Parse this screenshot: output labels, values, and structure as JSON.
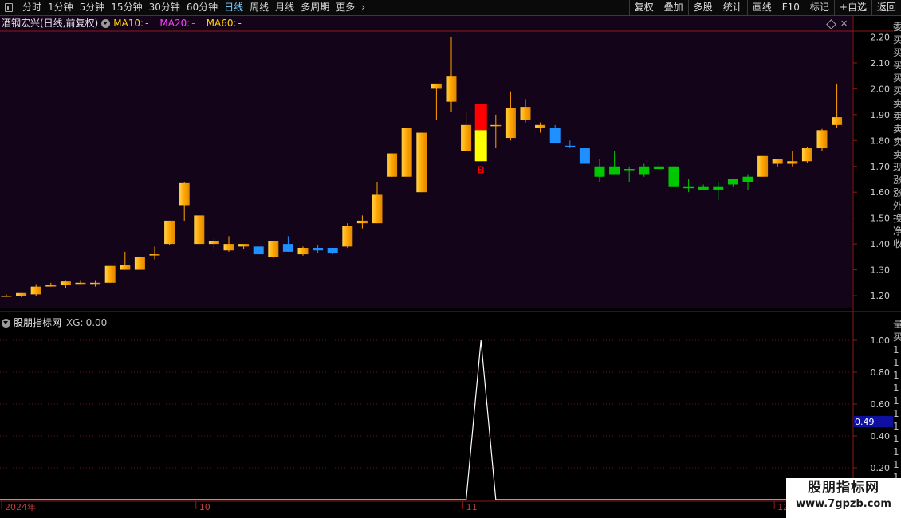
{
  "toolbar": {
    "periods": [
      {
        "label": "分时",
        "active": false
      },
      {
        "label": "1分钟",
        "active": false
      },
      {
        "label": "5分钟",
        "active": false
      },
      {
        "label": "15分钟",
        "active": false
      },
      {
        "label": "30分钟",
        "active": false
      },
      {
        "label": "60分钟",
        "active": false
      },
      {
        "label": "日线",
        "active": true
      },
      {
        "label": "周线",
        "active": false
      },
      {
        "label": "月线",
        "active": false
      },
      {
        "label": "多周期",
        "active": false
      },
      {
        "label": "更多",
        "active": false
      }
    ],
    "buttons": [
      "复权",
      "叠加",
      "多股",
      "统计",
      "画线",
      "F10",
      "标记",
      "+自选",
      "返回"
    ]
  },
  "main": {
    "stock_name": "酒钢宏兴(日线,前复权)",
    "ma": [
      {
        "label": "MA10:",
        "value": "-",
        "color": "#ffd700"
      },
      {
        "label": "MA20:",
        "value": "-",
        "color": "#ff40ff"
      },
      {
        "label": "MA60:",
        "value": "-",
        "color": "#ffd700"
      }
    ]
  },
  "indicator": {
    "name": "股朋指标网",
    "xg_label": "XG:",
    "xg_value": "0.00",
    "cursor_value": "0.49"
  },
  "watermark": {
    "line1": "股朋指标网",
    "line2": "www.7gpzb.com"
  },
  "right_strip_main": [
    "委",
    "买",
    "买",
    "买",
    "买",
    "买",
    "卖",
    "卖",
    "卖",
    "卖",
    "卖",
    "现",
    "涨",
    "涨",
    "外",
    "换",
    "净",
    "收"
  ],
  "right_strip_ind": [
    "量",
    "买",
    "1",
    "1",
    "1",
    "1",
    "1",
    "1",
    "1",
    "1",
    "1",
    "1",
    "1",
    "1",
    "1"
  ],
  "colors": {
    "up": "#ffa500",
    "up_light": "#ffd24a",
    "blue": "#1e90ff",
    "green": "#00c800",
    "signal_red": "#ff0000",
    "signal_yellow": "#ffff00",
    "panel_bg": "#14041a",
    "axis": "#8b1a1a"
  },
  "chart_data": [
    {
      "type": "candlestick",
      "title": "酒钢宏兴(日线,前复权)",
      "ylim": [
        1.16,
        2.22
      ],
      "y_ticks": [
        "1.20",
        "1.30",
        "1.40",
        "1.50",
        "1.60",
        "1.70",
        "1.80",
        "1.90",
        "2.00",
        "2.10",
        "2.20"
      ],
      "x_labels": [
        {
          "label": "2024年",
          "index": 0
        },
        {
          "label": "10",
          "index": 13
        },
        {
          "label": "11",
          "index": 31
        },
        {
          "label": "12",
          "index": 52
        }
      ],
      "candles": [
        {
          "o": 1.2,
          "h": 1.205,
          "l": 1.195,
          "c": 1.2,
          "color": "up"
        },
        {
          "o": 1.2,
          "h": 1.21,
          "l": 1.195,
          "c": 1.21,
          "color": "up"
        },
        {
          "o": 1.205,
          "h": 1.245,
          "l": 1.2,
          "c": 1.235,
          "color": "up"
        },
        {
          "o": 1.24,
          "h": 1.25,
          "l": 1.235,
          "c": 1.24,
          "color": "up"
        },
        {
          "o": 1.24,
          "h": 1.26,
          "l": 1.23,
          "c": 1.255,
          "color": "up"
        },
        {
          "o": 1.25,
          "h": 1.26,
          "l": 1.245,
          "c": 1.25,
          "color": "up"
        },
        {
          "o": 1.25,
          "h": 1.26,
          "l": 1.235,
          "c": 1.25,
          "color": "up"
        },
        {
          "o": 1.25,
          "h": 1.315,
          "l": 1.25,
          "c": 1.315,
          "color": "up"
        },
        {
          "o": 1.3,
          "h": 1.37,
          "l": 1.3,
          "c": 1.32,
          "color": "up"
        },
        {
          "o": 1.3,
          "h": 1.355,
          "l": 1.3,
          "c": 1.35,
          "color": "up"
        },
        {
          "o": 1.36,
          "h": 1.39,
          "l": 1.34,
          "c": 1.36,
          "color": "up"
        },
        {
          "o": 1.4,
          "h": 1.49,
          "l": 1.395,
          "c": 1.49,
          "color": "up"
        },
        {
          "o": 1.55,
          "h": 1.64,
          "l": 1.49,
          "c": 1.635,
          "color": "up"
        },
        {
          "o": 1.51,
          "h": 1.51,
          "l": 1.4,
          "c": 1.4,
          "color": "up"
        },
        {
          "o": 1.41,
          "h": 1.42,
          "l": 1.38,
          "c": 1.4,
          "color": "up"
        },
        {
          "o": 1.4,
          "h": 1.43,
          "l": 1.37,
          "c": 1.375,
          "color": "up"
        },
        {
          "o": 1.4,
          "h": 1.4,
          "l": 1.38,
          "c": 1.39,
          "color": "up"
        },
        {
          "o": 1.39,
          "h": 1.39,
          "l": 1.36,
          "c": 1.36,
          "color": "blue"
        },
        {
          "o": 1.41,
          "h": 1.41,
          "l": 1.345,
          "c": 1.35,
          "color": "up"
        },
        {
          "o": 1.4,
          "h": 1.43,
          "l": 1.37,
          "c": 1.37,
          "color": "blue"
        },
        {
          "o": 1.385,
          "h": 1.39,
          "l": 1.355,
          "c": 1.36,
          "color": "up"
        },
        {
          "o": 1.385,
          "h": 1.395,
          "l": 1.365,
          "c": 1.375,
          "color": "blue"
        },
        {
          "o": 1.385,
          "h": 1.385,
          "l": 1.36,
          "c": 1.365,
          "color": "blue"
        },
        {
          "o": 1.39,
          "h": 1.48,
          "l": 1.385,
          "c": 1.47,
          "color": "up"
        },
        {
          "o": 1.48,
          "h": 1.51,
          "l": 1.46,
          "c": 1.49,
          "color": "up"
        },
        {
          "o": 1.48,
          "h": 1.64,
          "l": 1.48,
          "c": 1.59,
          "color": "up"
        },
        {
          "o": 1.66,
          "h": 1.75,
          "l": 1.66,
          "c": 1.75,
          "color": "up"
        },
        {
          "o": 1.66,
          "h": 1.85,
          "l": 1.66,
          "c": 1.85,
          "color": "up"
        },
        {
          "o": 1.6,
          "h": 1.83,
          "l": 1.6,
          "c": 1.83,
          "color": "up"
        },
        {
          "o": 2.0,
          "h": 2.02,
          "l": 1.88,
          "c": 2.02,
          "color": "up"
        },
        {
          "o": 1.95,
          "h": 2.2,
          "l": 1.91,
          "c": 2.05,
          "color": "up"
        },
        {
          "o": 1.76,
          "h": 1.91,
          "l": 1.76,
          "c": 1.86,
          "color": "up"
        },
        {
          "o": 1.72,
          "h": 1.94,
          "l": 1.72,
          "c": 1.94,
          "color": "signal"
        },
        {
          "o": 1.86,
          "h": 1.9,
          "l": 1.77,
          "c": 1.86,
          "color": "up"
        },
        {
          "o": 1.81,
          "h": 1.99,
          "l": 1.8,
          "c": 1.925,
          "color": "up"
        },
        {
          "o": 1.88,
          "h": 1.96,
          "l": 1.87,
          "c": 1.93,
          "color": "up"
        },
        {
          "o": 1.85,
          "h": 1.87,
          "l": 1.83,
          "c": 1.86,
          "color": "up"
        },
        {
          "o": 1.85,
          "h": 1.86,
          "l": 1.79,
          "c": 1.79,
          "color": "blue"
        },
        {
          "o": 1.78,
          "h": 1.8,
          "l": 1.77,
          "c": 1.775,
          "color": "blue"
        },
        {
          "o": 1.77,
          "h": 1.77,
          "l": 1.71,
          "c": 1.71,
          "color": "blue"
        },
        {
          "o": 1.66,
          "h": 1.73,
          "l": 1.64,
          "c": 1.7,
          "color": "green"
        },
        {
          "o": 1.67,
          "h": 1.76,
          "l": 1.67,
          "c": 1.7,
          "color": "green"
        },
        {
          "o": 1.69,
          "h": 1.7,
          "l": 1.64,
          "c": 1.69,
          "color": "green"
        },
        {
          "o": 1.67,
          "h": 1.71,
          "l": 1.66,
          "c": 1.7,
          "color": "green"
        },
        {
          "o": 1.69,
          "h": 1.71,
          "l": 1.68,
          "c": 1.7,
          "color": "green"
        },
        {
          "o": 1.62,
          "h": 1.7,
          "l": 1.62,
          "c": 1.7,
          "color": "green"
        },
        {
          "o": 1.62,
          "h": 1.65,
          "l": 1.6,
          "c": 1.62,
          "color": "green"
        },
        {
          "o": 1.61,
          "h": 1.63,
          "l": 1.61,
          "c": 1.62,
          "color": "green"
        },
        {
          "o": 1.61,
          "h": 1.64,
          "l": 1.57,
          "c": 1.62,
          "color": "green"
        },
        {
          "o": 1.63,
          "h": 1.65,
          "l": 1.62,
          "c": 1.65,
          "color": "green"
        },
        {
          "o": 1.64,
          "h": 1.67,
          "l": 1.61,
          "c": 1.66,
          "color": "green"
        },
        {
          "o": 1.66,
          "h": 1.74,
          "l": 1.66,
          "c": 1.74,
          "color": "up"
        },
        {
          "o": 1.71,
          "h": 1.73,
          "l": 1.7,
          "c": 1.73,
          "color": "up"
        },
        {
          "o": 1.71,
          "h": 1.76,
          "l": 1.7,
          "c": 1.72,
          "color": "up"
        },
        {
          "o": 1.72,
          "h": 1.775,
          "l": 1.715,
          "c": 1.77,
          "color": "up"
        },
        {
          "o": 1.77,
          "h": 1.845,
          "l": 1.76,
          "c": 1.84,
          "color": "up"
        },
        {
          "o": 1.86,
          "h": 2.02,
          "l": 1.85,
          "c": 1.89,
          "color": "up"
        }
      ],
      "signal_marker": {
        "index": 32,
        "label": "B",
        "color": "#ff0000"
      }
    },
    {
      "type": "line",
      "title": "股朋指标网",
      "series": [
        {
          "name": "XG",
          "values": [
            0,
            0,
            0,
            0,
            0,
            0,
            0,
            0,
            0,
            0,
            0,
            0,
            0,
            0,
            0,
            0,
            0,
            0,
            0,
            0,
            0,
            0,
            0,
            0,
            0,
            0,
            0,
            0,
            0,
            0,
            0,
            0,
            1,
            0,
            0,
            0,
            0,
            0,
            0,
            0,
            0,
            0,
            0,
            0,
            0,
            0,
            0,
            0,
            0,
            0,
            0,
            0,
            0,
            0,
            0,
            0,
            0
          ],
          "color": "#ffffff"
        }
      ],
      "ylim": [
        0.0,
        1.06
      ],
      "y_ticks": [
        "0.20",
        "0.40",
        "0.60",
        "0.80",
        "1.00"
      ],
      "grid": true
    }
  ]
}
